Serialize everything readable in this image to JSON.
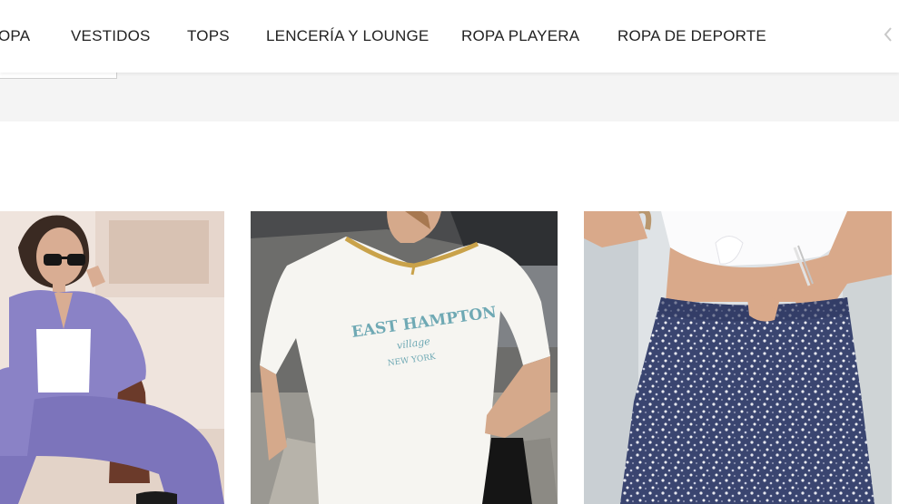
{
  "nav": {
    "items": [
      {
        "label": "OPA"
      },
      {
        "label": "VESTIDOS"
      },
      {
        "label": "TOPS"
      },
      {
        "label": "LENCERÍA Y LOUNGE"
      },
      {
        "label": "ROPA PLAYERA"
      },
      {
        "label": "ROPA DE DEPORTE"
      }
    ],
    "arrow_icon": "chevron-left-icon"
  },
  "products": [
    {
      "image": "woman-lavender-suit-sunglasses"
    },
    {
      "image": "woman-white-tshirt-east-hampton",
      "print": {
        "line1": "EAST HAMPTON",
        "line2": "village",
        "line3": "NEW YORK"
      }
    },
    {
      "image": "woman-white-crop-top-floral-skirt"
    }
  ],
  "colors": {
    "nav_text": "#222222",
    "band": "#f4f4f4",
    "suit": "#8a82c6",
    "tshirt_print": "#6fa9b4",
    "skirt": "#3a4570"
  }
}
